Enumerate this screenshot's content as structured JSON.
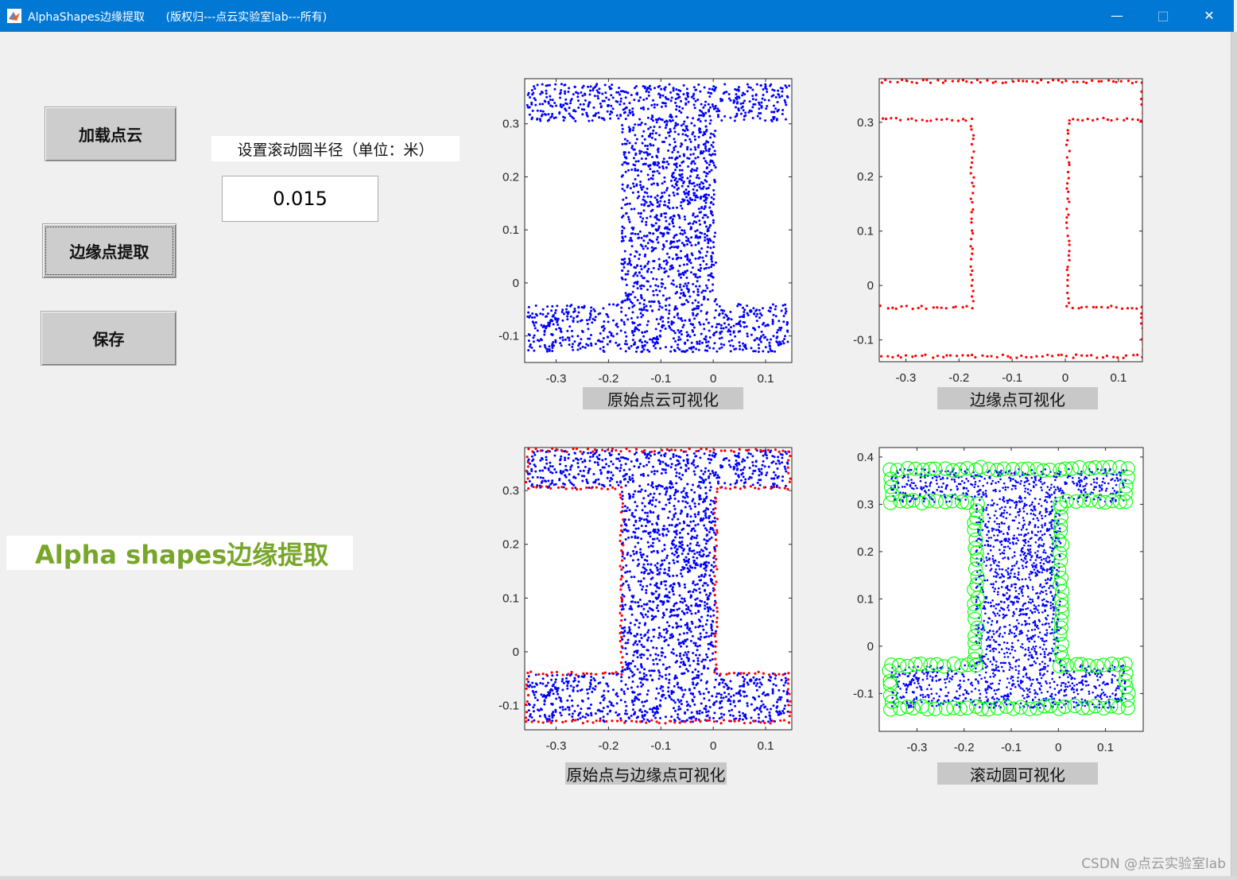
{
  "window": {
    "title": "AlphaShapes边缘提取      (版权归---点云实验室lab---所有)",
    "minimize": "—",
    "maximize": "□",
    "close": "✕",
    "icon": "matlab-icon"
  },
  "controls": {
    "load_label": "加载点云",
    "extract_label": "边缘点提取",
    "save_label": "保存",
    "radius_label": "设置滚动圆半径（单位：米）",
    "radius_value": "0.015"
  },
  "banner": {
    "text": "Alpha shapes边缘提取"
  },
  "watermark": "CSDN @点云实验室lab",
  "colors": {
    "blue_points": "#0000ff",
    "red_points": "#ff0000",
    "green_circles": "#00ff00",
    "banner_text": "#78a62a"
  },
  "chart_data": [
    {
      "type": "scatter",
      "caption": "原始点云可视化",
      "xlim": [
        -0.36,
        0.15
      ],
      "ylim": [
        -0.15,
        0.385
      ],
      "xticks": [
        "-0.3",
        "-0.2",
        "-0.1",
        "0",
        "0.1"
      ],
      "yticks": [
        "0.3",
        "0.2",
        "0.1",
        "0",
        "-0.1"
      ],
      "series": [
        {
          "color": "#0000ff",
          "shape": "I-beam interior points"
        }
      ]
    },
    {
      "type": "scatter",
      "caption": "边缘点可视化",
      "xlim": [
        -0.35,
        0.145
      ],
      "ylim": [
        -0.14,
        0.38
      ],
      "xticks": [
        "-0.3",
        "-0.2",
        "-0.1",
        "0",
        "0.1"
      ],
      "yticks": [
        "0.3",
        "0.2",
        "0.1",
        "0",
        "-0.1"
      ],
      "series": [
        {
          "color": "#ff0000",
          "shape": "I-beam boundary points"
        }
      ]
    },
    {
      "type": "scatter",
      "caption": "原始点与边缘点可视化",
      "xlim": [
        -0.36,
        0.15
      ],
      "ylim": [
        -0.145,
        0.38
      ],
      "xticks": [
        "-0.3",
        "-0.2",
        "-0.1",
        "0",
        "0.1"
      ],
      "yticks": [
        "0.3",
        "0.2",
        "0.1",
        "0",
        "-0.1"
      ],
      "series": [
        {
          "color": "#0000ff"
        },
        {
          "color": "#ff0000"
        }
      ]
    },
    {
      "type": "scatter",
      "caption": "滚动圆可视化",
      "xlim": [
        -0.38,
        0.18
      ],
      "ylim": [
        -0.18,
        0.42
      ],
      "xticks": [
        "-0.3",
        "-0.2",
        "-0.1",
        "0",
        "0.1"
      ],
      "yticks": [
        "0.4",
        "0.3",
        "0.2",
        "0.1",
        "0",
        "-0.1"
      ],
      "series": [
        {
          "color": "#0000ff"
        },
        {
          "color": "#00ff00",
          "marker": "circle"
        }
      ]
    }
  ]
}
